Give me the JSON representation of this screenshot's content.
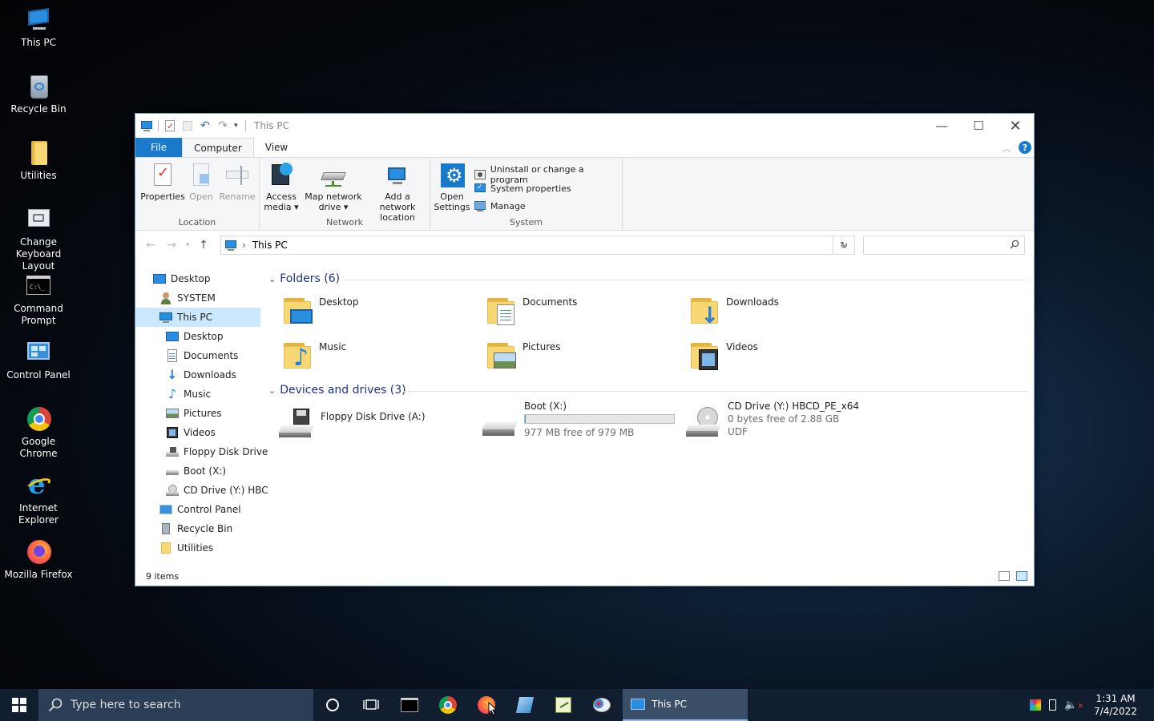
{
  "desktop": {
    "icons": [
      {
        "label": "This PC",
        "icon": "computer-icon"
      },
      {
        "label": "Recycle Bin",
        "icon": "recycle-bin-icon"
      },
      {
        "label": "Utilities",
        "icon": "folder-icon"
      },
      {
        "label": "Change Keyboard Layout",
        "icon": "keyboard-icon"
      },
      {
        "label": "Command Prompt",
        "icon": "cmd-icon"
      },
      {
        "label": "Control Panel",
        "icon": "control-panel-icon"
      },
      {
        "label": "Google Chrome",
        "icon": "chrome-icon"
      },
      {
        "label": "Internet Explorer",
        "icon": "ie-icon"
      },
      {
        "label": "Mozilla Firefox",
        "icon": "firefox-icon"
      }
    ]
  },
  "window": {
    "title": "This PC",
    "controls": {
      "minimize": "—",
      "maximize": "☐",
      "close": "✕"
    }
  },
  "ribbon": {
    "tabs": {
      "file": "File",
      "computer": "Computer",
      "view": "View"
    },
    "help": "?",
    "location": {
      "label": "Location",
      "properties": "Properties",
      "open": "Open",
      "rename": "Rename"
    },
    "network": {
      "label": "Network",
      "access_media_1": "Access",
      "access_media_2": "media ▾",
      "map_drive_1": "Map network",
      "map_drive_2": "drive ▾",
      "add_location_1": "Add a network",
      "add_location_2": "location"
    },
    "system": {
      "label": "System",
      "open_settings_1": "Open",
      "open_settings_2": "Settings",
      "uninstall": "Uninstall or change a program",
      "system_properties": "System properties",
      "manage": "Manage"
    }
  },
  "address": {
    "path": "This PC",
    "separator": "›"
  },
  "navpane": {
    "items": [
      {
        "label": "Desktop"
      },
      {
        "label": "SYSTEM"
      },
      {
        "label": "This PC"
      },
      {
        "label": "Desktop"
      },
      {
        "label": "Documents"
      },
      {
        "label": "Downloads"
      },
      {
        "label": "Music"
      },
      {
        "label": "Pictures"
      },
      {
        "label": "Videos"
      },
      {
        "label": "Floppy Disk Drive"
      },
      {
        "label": "Boot (X:)"
      },
      {
        "label": "CD Drive (Y:) HBC"
      },
      {
        "label": "Control Panel"
      },
      {
        "label": "Recycle Bin"
      },
      {
        "label": "Utilities"
      }
    ]
  },
  "content": {
    "folders_header": "Folders (6)",
    "folders": [
      {
        "label": "Desktop"
      },
      {
        "label": "Documents"
      },
      {
        "label": "Downloads"
      },
      {
        "label": "Music"
      },
      {
        "label": "Pictures"
      },
      {
        "label": "Videos"
      }
    ],
    "devices_header": "Devices and drives (3)",
    "drives": [
      {
        "label": "Floppy Disk Drive (A:)"
      },
      {
        "label": "Boot (X:)",
        "free": "977 MB free of 979 MB",
        "used_fraction": 0.002
      },
      {
        "label": "CD Drive (Y:) HBCD_PE_x64",
        "free": "0 bytes free of 2.88 GB",
        "fs": "UDF"
      }
    ]
  },
  "status": {
    "items": "9 items"
  },
  "taskbar": {
    "search_placeholder": "Type here to search",
    "active_window": "This PC",
    "time": "1:31 AM",
    "date": "7/4/2022"
  },
  "colors": {
    "accent": "#1979ca",
    "selection": "#cce8ff",
    "section_header": "#1e3287",
    "taskbar": "#101e30"
  }
}
